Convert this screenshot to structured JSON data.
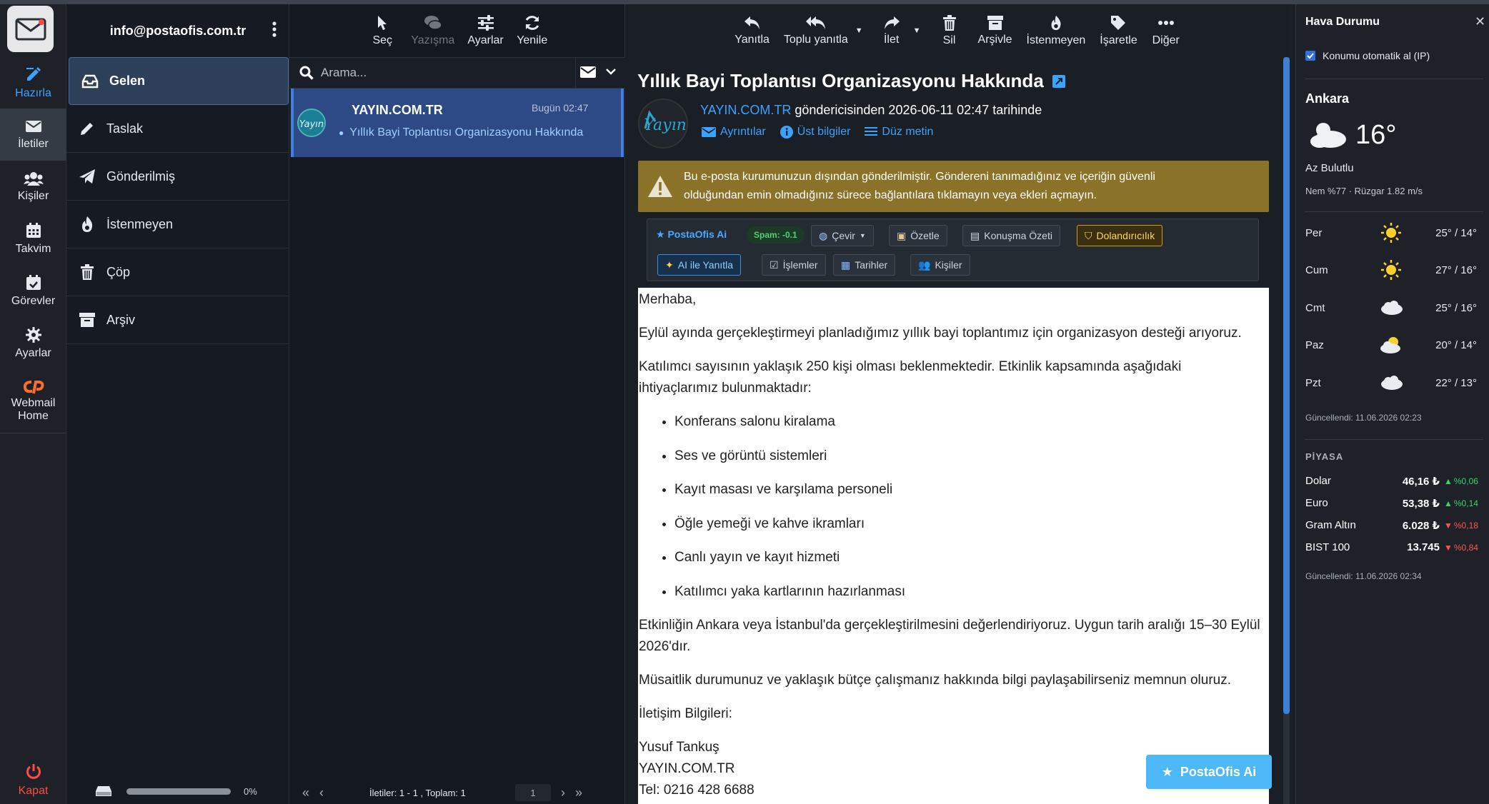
{
  "account": {
    "email": "info@postaofis.com.tr"
  },
  "rail": {
    "items": [
      {
        "label": "Hazırla"
      },
      {
        "label": "İletiler"
      },
      {
        "label": "Kişiler"
      },
      {
        "label": "Takvim"
      },
      {
        "label": "Görevler"
      },
      {
        "label": "Ayarlar"
      },
      {
        "label": "Webmail Home"
      }
    ],
    "logout": "Kapat"
  },
  "folders": [
    {
      "label": "Gelen",
      "icon": "inbox-icon"
    },
    {
      "label": "Taslak",
      "icon": "pencil-icon"
    },
    {
      "label": "Gönderilmiş",
      "icon": "paper-plane-icon"
    },
    {
      "label": "İstenmeyen",
      "icon": "fire-icon"
    },
    {
      "label": "Çöp",
      "icon": "trash-icon"
    },
    {
      "label": "Arşiv",
      "icon": "archive-icon"
    }
  ],
  "quota": {
    "percent_label": "0%",
    "fraction": 0
  },
  "list_toolbar": {
    "select": "Seç",
    "threads": "Yazışma",
    "options": "Ayarlar",
    "refresh": "Yenile"
  },
  "search": {
    "placeholder": "Arama..."
  },
  "message": {
    "from": "YAYIN.COM.TR",
    "time": "Bugün 02:47",
    "subject": "Yıllık Bayi Toplantısı Organizasyonu Hakkında"
  },
  "list_footer": {
    "count": "İletiler: 1 - 1 , Toplam: 1",
    "page": "1"
  },
  "pane_toolbar": {
    "reply": "Yanıtla",
    "reply_all": "Toplu yanıtla",
    "forward": "İlet",
    "delete": "Sil",
    "archive": "Arşivle",
    "junk": "İstenmeyen",
    "mark": "İşaretle",
    "more": "Diğer"
  },
  "email": {
    "subject": "Yıllık Bayi Toplantısı Organizasyonu Hakkında",
    "sender_link": "YAYIN.COM.TR",
    "sender_rest": " göndericisinden 2026-06-11 02:47 tarihinde",
    "details": "Ayrıntılar",
    "headers": "Üst bilgiler",
    "plain": "Düz metin",
    "warning_line1": "Bu e-posta kurumunuzun dışından gönderilmiştir. Göndereni tanımadığınız ve içeriğin güvenli",
    "warning_line2": "olduğundan emin olmadığınız sürece bağlantılara tıklamayın veya ekleri açmayın.",
    "body": {
      "greeting": "Merhaba,",
      "p1": "Eylül ayında gerçekleştirmeyi planladığımız yıllık bayi toplantımız için organizasyon desteği arıyoruz.",
      "p2": "Katılımcı sayısının yaklaşık 250 kişi olması beklenmektedir. Etkinlik kapsamında aşağıdaki ihtiyaçlarımız bulunmaktadır:",
      "items": [
        "Konferans salonu kiralama",
        "Ses ve görüntü sistemleri",
        "Kayıt masası ve karşılama personeli",
        "Öğle yemeği ve kahve ikramları",
        "Canlı yayın ve kayıt hizmeti",
        "Katılımcı yaka kartlarının hazırlanması"
      ],
      "p3": "Etkinliğin Ankara veya İstanbul'da gerçekleştirilmesini değerlendiriyoruz. Uygun tarih aralığı 15–30 Eylül 2026'dır.",
      "p4": "Müsaitlik durumunuz ve yaklaşık bütçe çalışmanız hakkında bilgi paylaşabilirseniz memnun oluruz.",
      "contact_title": "İletişim Bilgileri:",
      "sig_name": "Yusuf Tankuş",
      "sig_company": "YAYIN.COM.TR",
      "sig_phone": "Tel: 0216 428 6688"
    }
  },
  "ai": {
    "title": "★ PostaOfis Ai",
    "spam": "Spam: -0.1",
    "translate": "Çevir",
    "summarize": "Özetle",
    "thread_summary": "Konuşma Özeti",
    "fraud": "Dolandırıcılık",
    "ai_reply": "AI ile Yanıtla",
    "tasks": "İşlemler",
    "dates": "Tarihler",
    "contacts": "Kişiler",
    "fab": "PostaOfis Ai"
  },
  "weather": {
    "title": "Hava Durumu",
    "auto_location": "Konumu otomatik al (IP)",
    "city": "Ankara",
    "temp": "16°",
    "desc": "Az Bulutlu",
    "meta": "Nem %77 · Rüzgar 1.82 m/s",
    "forecast": [
      {
        "day": "Per",
        "icon": "sun-icon",
        "temp": "25° / 14°"
      },
      {
        "day": "Cum",
        "icon": "sun-icon",
        "temp": "27° / 16°"
      },
      {
        "day": "Cmt",
        "icon": "cloud-icon",
        "temp": "25° / 16°"
      },
      {
        "day": "Paz",
        "icon": "partly-cloudy-icon",
        "temp": "20° / 14°"
      },
      {
        "day": "Pzt",
        "icon": "cloud-icon",
        "temp": "22° / 13°"
      }
    ],
    "updated": "Güncellendi: 11.06.2026 02:23"
  },
  "market": {
    "title": "PİYASA",
    "rows": [
      {
        "name": "Dolar",
        "value": "46,16 ₺",
        "change": "%0,06",
        "dir": "up"
      },
      {
        "name": "Euro",
        "value": "53,38 ₺",
        "change": "%0,14",
        "dir": "up"
      },
      {
        "name": "Gram Altın",
        "value": "6.028 ₺",
        "change": "%0,18",
        "dir": "down"
      },
      {
        "name": "BIST 100",
        "value": "13.745",
        "change": "%0,84",
        "dir": "down"
      }
    ],
    "updated": "Güncellendi: 11.06.2026 02:34"
  },
  "colors": {
    "accent": "#3aa3ff",
    "warning": "#8a7228",
    "selected_row": "#2d4a86"
  }
}
